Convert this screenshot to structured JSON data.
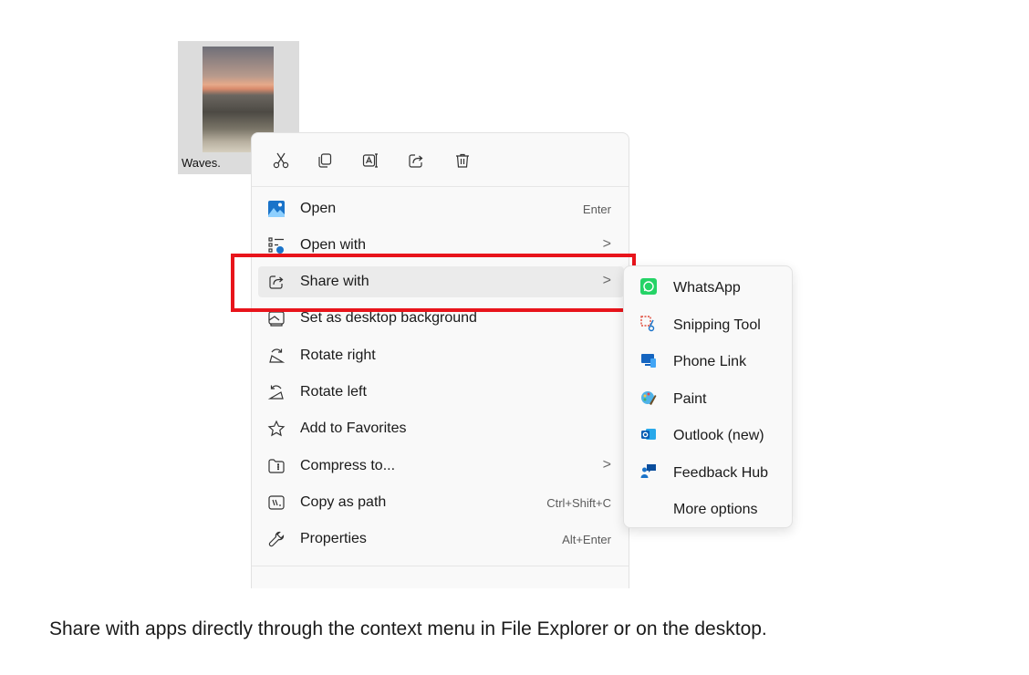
{
  "file": {
    "name": "Waves."
  },
  "quick_actions": [
    {
      "id": "cut",
      "icon": "scissors-icon"
    },
    {
      "id": "copy",
      "icon": "copy-icon"
    },
    {
      "id": "rename",
      "icon": "rename-icon"
    },
    {
      "id": "share",
      "icon": "share-icon"
    },
    {
      "id": "delete",
      "icon": "trash-icon"
    }
  ],
  "menu": {
    "items": [
      {
        "label": "Open",
        "shortcut": "Enter",
        "icon": "photos-app-icon"
      },
      {
        "label": "Open with",
        "chevron": ">",
        "icon": "open-with-icon"
      },
      {
        "label": "Share with",
        "chevron": ">",
        "icon": "share-icon"
      },
      {
        "label": "Set as desktop background",
        "icon": "desktop-background-icon"
      },
      {
        "label": "Rotate right",
        "icon": "rotate-right-icon"
      },
      {
        "label": "Rotate left",
        "icon": "rotate-left-icon"
      },
      {
        "label": "Add to Favorites",
        "icon": "star-icon"
      },
      {
        "label": "Compress to...",
        "chevron": ">",
        "icon": "zip-folder-icon"
      },
      {
        "label": "Copy as path",
        "shortcut": "Ctrl+Shift+C",
        "icon": "copy-path-icon"
      },
      {
        "label": "Properties",
        "shortcut": "Alt+Enter",
        "icon": "wrench-icon"
      }
    ]
  },
  "submenu": {
    "items": [
      {
        "label": "WhatsApp",
        "icon": "whatsapp-icon"
      },
      {
        "label": "Snipping Tool",
        "icon": "snipping-tool-icon"
      },
      {
        "label": "Phone Link",
        "icon": "phone-link-icon"
      },
      {
        "label": "Paint",
        "icon": "paint-icon"
      },
      {
        "label": "Outlook (new)",
        "icon": "outlook-icon"
      },
      {
        "label": "Feedback Hub",
        "icon": "feedback-hub-icon"
      },
      {
        "label": "More options"
      }
    ]
  },
  "caption": "Share with apps directly through the context menu in File Explorer or on the desktop.",
  "colors": {
    "highlight": "#e8141b",
    "menu_bg": "#f9f9f9",
    "hover_bg": "#ebebeb"
  }
}
